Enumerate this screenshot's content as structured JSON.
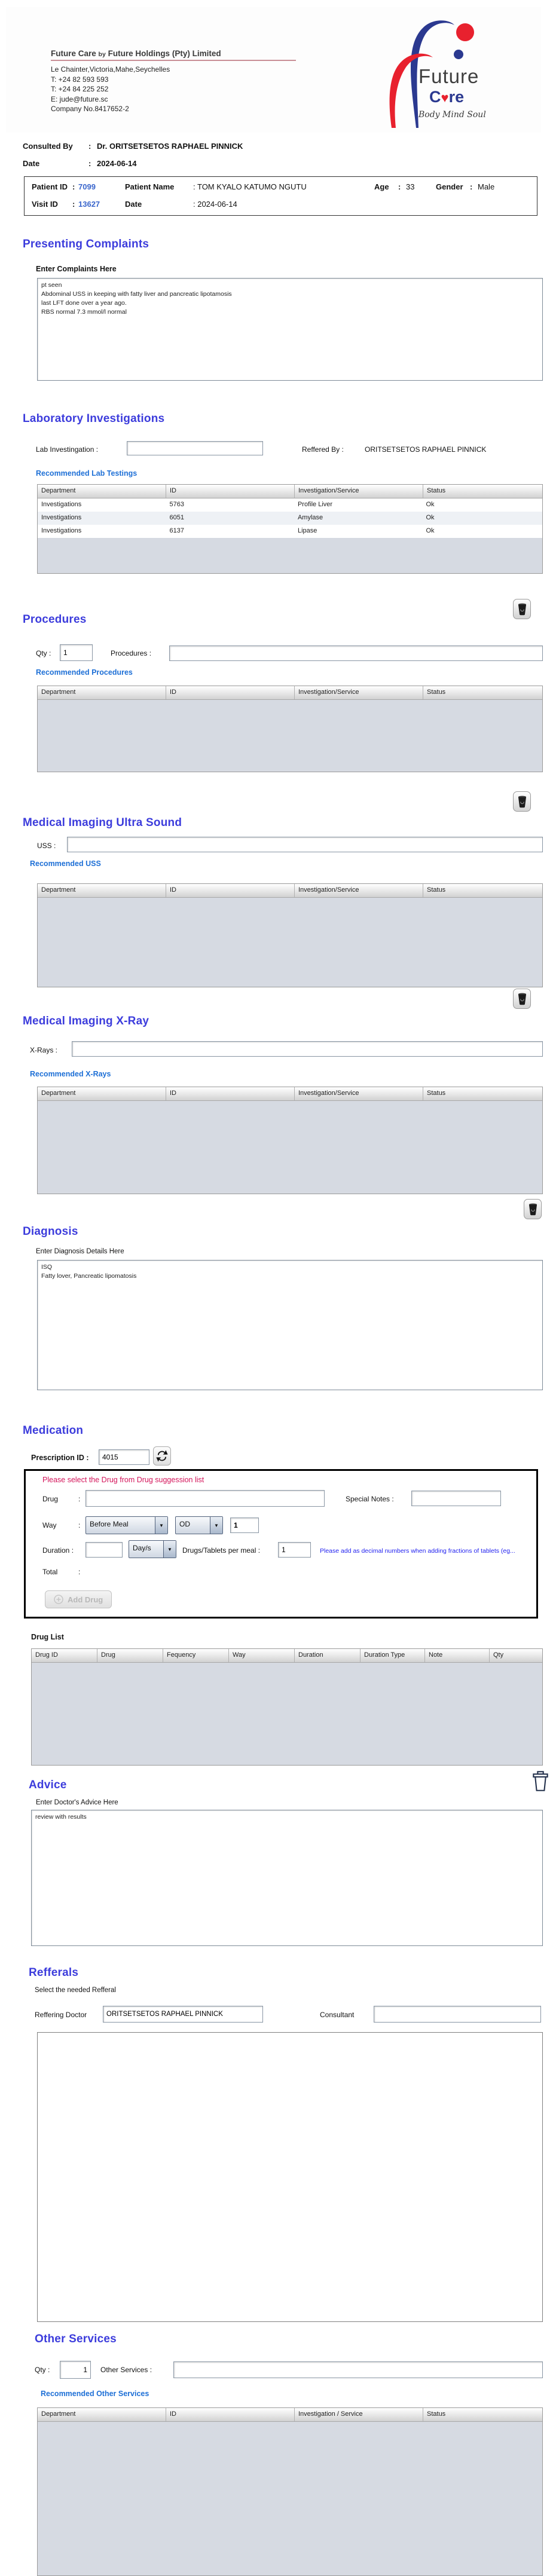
{
  "header": {
    "company_main": "Future Care",
    "company_by": "by",
    "company_rest": "Future Holdings (Pty) Limited",
    "address": [
      "Le Chainter,Victoria,Mahe,Seychelles",
      "T: +24  82 593 593",
      "T: +24  84 225 252",
      "E: jude@future.sc",
      "Company No.8417652-2"
    ],
    "logo": {
      "word1": "Future",
      "care_c": "C",
      "care_heart": "♥",
      "care_re": "re",
      "tagline": "Body Mind Soul"
    }
  },
  "consulted": {
    "label": "Consulted By",
    "colon": ":",
    "value": "Dr.  ORITSETSETOS RAPHAEL PINNICK"
  },
  "date_row": {
    "label": "Date",
    "colon": ":",
    "value": "2024-06-14"
  },
  "patient": {
    "pid_label": "Patient ID",
    "pid_colon": ":",
    "pid": "7099",
    "name_label": "Patient Name",
    "name_value": ": TOM KYALO KATUMO NGUTU",
    "age_label": "Age",
    "age_colon": ":",
    "age": "33",
    "gender_label": "Gender",
    "gender_colon": ":",
    "gender": "Male",
    "visit_label": "Visit ID",
    "visit_colon": ":",
    "visit": "13627",
    "date_label": "Date",
    "date_value": ": 2024-06-14"
  },
  "complaints": {
    "title": "Presenting Complaints",
    "label": "Enter Complaints Here",
    "text": "pt seen\nAbdominal USS in keeping with fatty liver and pancreatic lipotamosis\nlast LFT done over a year ago.\nRBS normal 7.3 mmol/l normal"
  },
  "laboratory": {
    "title": "Laboratory  Investigations",
    "lab_label": "Lab Investingation :",
    "reffered_label": "Reffered By :",
    "reffered_value": "ORITSETSETOS RAPHAEL PINNICK",
    "link": "Recommended Lab Testings",
    "headers": [
      "Department",
      "ID",
      "Investigation/Service",
      "Status"
    ],
    "rows": [
      [
        "Investigations",
        "5763",
        "Profile Liver",
        "Ok"
      ],
      [
        "Investigations",
        "6051",
        "Amylase",
        "Ok"
      ],
      [
        "Investigations",
        "6137",
        "Lipase",
        "Ok"
      ]
    ]
  },
  "procedures": {
    "title": "Procedures",
    "qty_label": "Qty :",
    "qty": "1",
    "proc_label": "Procedures :",
    "link": "Recommended Procedures",
    "headers": [
      "Department",
      "ID",
      "Investigation/Service",
      "Status"
    ]
  },
  "uss": {
    "title": "Medical Imaging Ultra Sound",
    "label": "USS :",
    "link": "Recommended USS",
    "headers": [
      "Department",
      "ID",
      "Investigation/Service",
      "Status"
    ]
  },
  "xray": {
    "title": "Medical Imaging X-Ray",
    "label": "X-Rays :",
    "link": "Recommended X-Rays",
    "headers": [
      "Department",
      "ID",
      "Investigation/Service",
      "Status"
    ]
  },
  "diagnosis": {
    "title": "Diagnosis",
    "label": "Enter Diagnosis Details Here",
    "text": "ISQ\nFatty lover, Pancreatic lipomatosis"
  },
  "medication": {
    "title": "Medication",
    "prescription_label": "Prescription ID :",
    "prescription_id": "4015",
    "warning": "Please select the Drug from Drug suggession list",
    "drug_label": "Drug",
    "drug_colon": ":",
    "special_label": "Special Notes  :",
    "way_label": "Way",
    "way_colon": ":",
    "way_value": "Before Meal",
    "freq_value": "OD",
    "way_qty": "1",
    "duration_label": "Duration :",
    "duration_type": "Day/s",
    "per_meal_label": "Drugs/Tablets per meal :",
    "per_meal": "1",
    "hint": "Please add as decimal numbers when adding fractions of tablets (eg...",
    "total_label": "Total",
    "total_colon": ":",
    "add_drug_label": "Add Drug"
  },
  "drug_list": {
    "label": "Drug List",
    "headers": [
      "Drug ID",
      "Drug",
      "Fequency",
      "Way",
      "Duration",
      "Duration Type",
      "Note",
      "Qty"
    ]
  },
  "advice": {
    "title": "Advice",
    "label": "Enter Doctor's Advice Here",
    "text": "review with results"
  },
  "refferals": {
    "title": "Refferals",
    "sub": "Select the needed Refferal",
    "doctor_label": "Reffering Doctor",
    "doctor_value": "ORITSETSETOS RAPHAEL PINNICK",
    "consultant_label": "Consultant"
  },
  "other_services": {
    "title": "Other Services",
    "qty_label": "Qty :",
    "qty": "1",
    "svc_label": "Other Services :",
    "link": "Recommended Other Services",
    "headers": [
      "Department",
      "ID",
      "Investigation / Service",
      "Status"
    ]
  },
  "colors": {
    "section_heading": "#3c3cdc",
    "link_blue": "#1d6fd6",
    "id_blue": "#3a66cc",
    "warning_red": "#d4145a",
    "hint_blue": "#2323f0",
    "logo_blue": "#2b3990",
    "logo_red": "#e8212e",
    "table_body": "#d6dae2"
  },
  "dropdown_arrow": "▼"
}
